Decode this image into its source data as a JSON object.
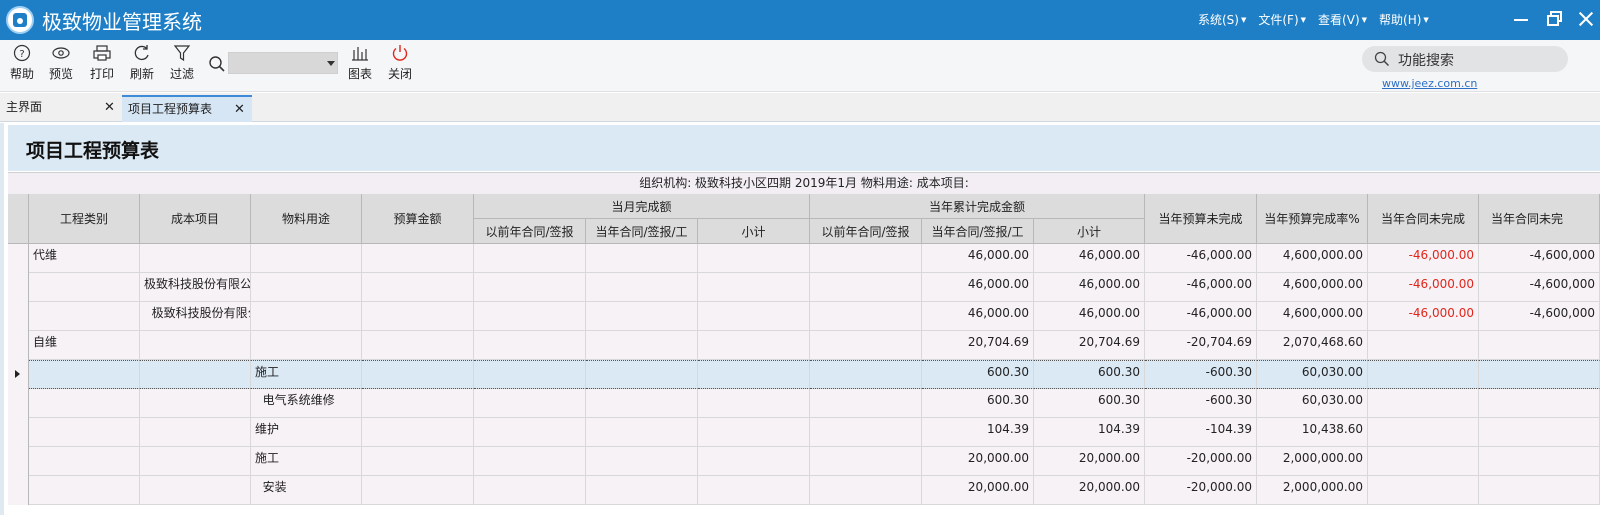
{
  "app": {
    "title": "极致物业管理系统",
    "menus": [
      "系统(S)",
      "文件(F)",
      "查看(V)",
      "帮助(H)"
    ]
  },
  "toolbar": {
    "help": "帮助",
    "preview": "预览",
    "print": "打印",
    "refresh": "刷新",
    "filter": "过滤",
    "chart": "图表",
    "close": "关闭",
    "search_value": "",
    "function_search": "功能搜索",
    "link": "www.jeez.com.cn"
  },
  "tabs": {
    "main": "主界面",
    "budget": "项目工程预算表",
    "close_glyph": "✕"
  },
  "report": {
    "title": "项目工程预算表",
    "filter_line": "组织机构: 极致科技小区四期  2019年1月 物料用途:  成本项目:"
  },
  "columns": {
    "project_type": "工程类别",
    "cost_item": "成本项目",
    "material_use": "物料用途",
    "budget_amount": "预算金额",
    "month_group": "当月完成额",
    "year_group": "当年累计完成金额",
    "prior_contract": "以前年合同/签报",
    "current_contract": "当年合同/签报/工",
    "subtotal": "小计",
    "year_unfinished": "当年预算未完成",
    "year_rate": "当年预算完成率%",
    "contract_unfinished": "当年合同未完成",
    "contract_unfinished2": "当年合同未完"
  },
  "rows": [
    {
      "type": "代维",
      "cost": "",
      "use": "",
      "budget": "",
      "m_prior": "",
      "m_cur": "",
      "m_sub": "",
      "y_prior": "",
      "y_cur": "46,000.00",
      "y_sub": "46,000.00",
      "unfinished": "-46,000.00",
      "rate": "4,600,000.00",
      "c_unfinished": "-46,000.00",
      "c_unfinished2": "-4,600,000"
    },
    {
      "type": "",
      "cost": "极致科技股份有限公司",
      "use": "",
      "budget": "",
      "m_prior": "",
      "m_cur": "",
      "m_sub": "",
      "y_prior": "",
      "y_cur": "46,000.00",
      "y_sub": "46,000.00",
      "unfinished": "-46,000.00",
      "rate": "4,600,000.00",
      "c_unfinished": "-46,000.00",
      "c_unfinished2": "-4,600,000"
    },
    {
      "type": "",
      "cost": "  极致科技股份有限公司",
      "use": "",
      "budget": "",
      "m_prior": "",
      "m_cur": "",
      "m_sub": "",
      "y_prior": "",
      "y_cur": "46,000.00",
      "y_sub": "46,000.00",
      "unfinished": "-46,000.00",
      "rate": "4,600,000.00",
      "c_unfinished": "-46,000.00",
      "c_unfinished2": "-4,600,000"
    },
    {
      "type": "自维",
      "cost": "",
      "use": "",
      "budget": "",
      "m_prior": "",
      "m_cur": "",
      "m_sub": "",
      "y_prior": "",
      "y_cur": "20,704.69",
      "y_sub": "20,704.69",
      "unfinished": "-20,704.69",
      "rate": "2,070,468.60",
      "c_unfinished": "",
      "c_unfinished2": ""
    },
    {
      "type": "",
      "cost": "",
      "use": "施工",
      "budget": "",
      "m_prior": "",
      "m_cur": "",
      "m_sub": "",
      "y_prior": "",
      "y_cur": "600.30",
      "y_sub": "600.30",
      "unfinished": "-600.30",
      "rate": "60,030.00",
      "c_unfinished": "",
      "c_unfinished2": ""
    },
    {
      "type": "",
      "cost": "",
      "use": "  电气系统维修",
      "budget": "",
      "m_prior": "",
      "m_cur": "",
      "m_sub": "",
      "y_prior": "",
      "y_cur": "600.30",
      "y_sub": "600.30",
      "unfinished": "-600.30",
      "rate": "60,030.00",
      "c_unfinished": "",
      "c_unfinished2": ""
    },
    {
      "type": "",
      "cost": "",
      "use": "维护",
      "budget": "",
      "m_prior": "",
      "m_cur": "",
      "m_sub": "",
      "y_prior": "",
      "y_cur": "104.39",
      "y_sub": "104.39",
      "unfinished": "-104.39",
      "rate": "10,438.60",
      "c_unfinished": "",
      "c_unfinished2": ""
    },
    {
      "type": "",
      "cost": "",
      "use": "施工",
      "budget": "",
      "m_prior": "",
      "m_cur": "",
      "m_sub": "",
      "y_prior": "",
      "y_cur": "20,000.00",
      "y_sub": "20,000.00",
      "unfinished": "-20,000.00",
      "rate": "2,000,000.00",
      "c_unfinished": "",
      "c_unfinished2": ""
    },
    {
      "type": "",
      "cost": "",
      "use": "  安装",
      "budget": "",
      "m_prior": "",
      "m_cur": "",
      "m_sub": "",
      "y_prior": "",
      "y_cur": "20,000.00",
      "y_sub": "20,000.00",
      "unfinished": "-20,000.00",
      "rate": "2,000,000.00",
      "c_unfinished": "",
      "c_unfinished2": ""
    }
  ],
  "colors": {
    "titlebar": "#1f7fc6",
    "negative_highlight": "#e0261c",
    "selected_row": "#dbe9f5",
    "header_bg": "#dcdcdc"
  }
}
